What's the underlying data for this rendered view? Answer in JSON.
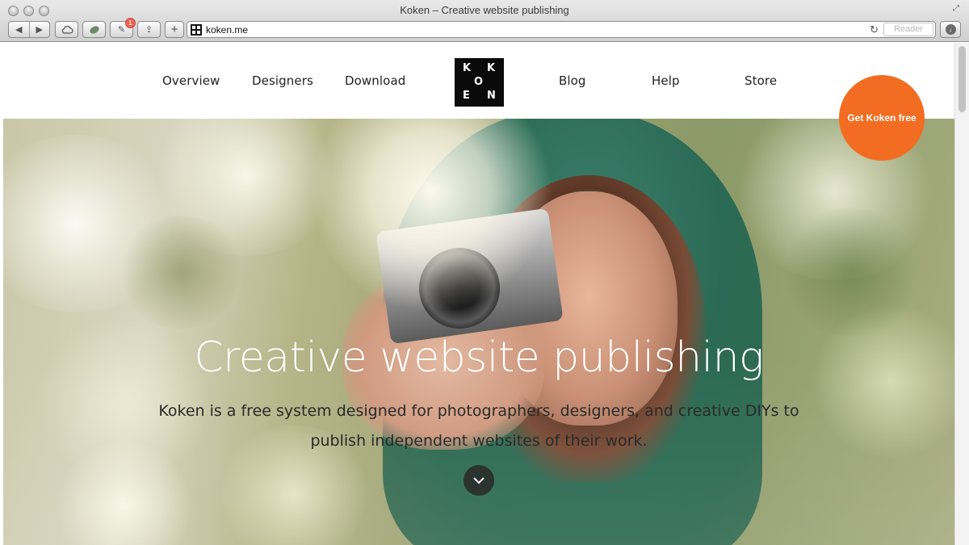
{
  "window": {
    "title": "Koken – Creative website publishing"
  },
  "toolbar": {
    "url": "koken.me",
    "reader_label": "Reader",
    "badge_count": "1",
    "plus_label": "+",
    "back_icon": "back-arrow-icon",
    "forward_icon": "forward-arrow-icon"
  },
  "nav": {
    "items": [
      {
        "label": "Overview"
      },
      {
        "label": "Designers"
      },
      {
        "label": "Download"
      },
      {
        "label": "Blog"
      },
      {
        "label": "Help"
      },
      {
        "label": "Store"
      }
    ],
    "logo_letters": [
      "K",
      "K",
      "O",
      "E",
      "N"
    ]
  },
  "hero": {
    "title": "Creative website publishing",
    "subtitle": "Koken is a free system designed for photographers, designers, and creative DIYs to publish independent websites of their work."
  },
  "cta": {
    "label": "Get Koken free",
    "color": "#f26d21"
  }
}
